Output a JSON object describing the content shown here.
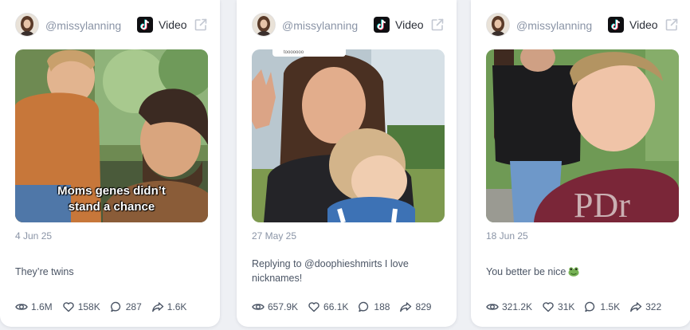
{
  "cards": [
    {
      "username": "@missylanning",
      "platform": "Video",
      "overlay_text": "Moms genes didn’t stand a chance",
      "date": "4 Jun 25",
      "text": "They’re twins",
      "stats": {
        "views": "1.6M",
        "likes": "158K",
        "comments": "287",
        "shares": "1.6K"
      }
    },
    {
      "username": "@missylanning",
      "platform": "Video",
      "overlay_text": "tooooooo",
      "date": "27 May 25",
      "text": "Replying to @doophieshmirts I love nicknames!",
      "stats": {
        "views": "657.9K",
        "likes": "66.1K",
        "comments": "188",
        "shares": "829"
      }
    },
    {
      "username": "@missylanning",
      "platform": "Video",
      "date": "18 Jun 25",
      "text": "You better be nice",
      "stats": {
        "views": "321.2K",
        "likes": "31K",
        "comments": "1.5K",
        "shares": "322"
      }
    }
  ],
  "icons": [
    "avatar",
    "tiktok-icon",
    "external-link-icon",
    "eye-icon",
    "heart-icon",
    "comment-icon",
    "share-icon",
    "frog-emoji"
  ],
  "colors": {
    "page_bg": "#eef0f4",
    "card_bg": "#ffffff",
    "muted_text": "#8a94a6",
    "body_text": "#4b5565",
    "tiktok_bg": "#0f0f12"
  }
}
